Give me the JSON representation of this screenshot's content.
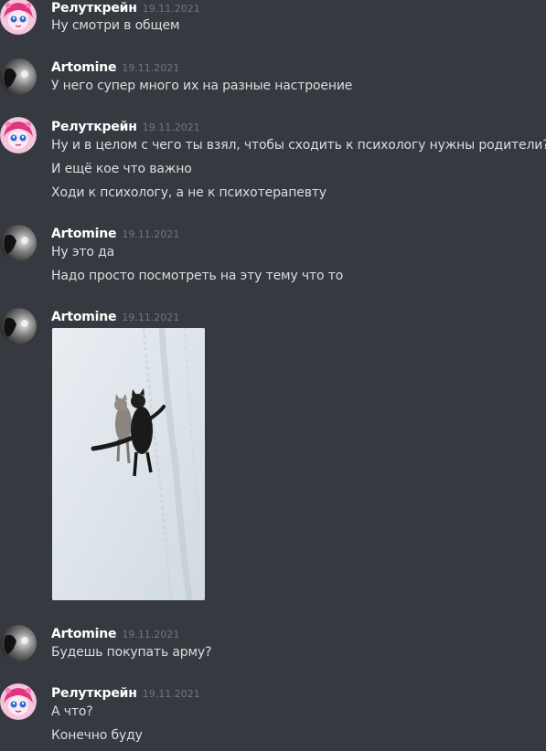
{
  "messages": [
    {
      "author": "Релуткрейн",
      "timestamp": "19.11.2021",
      "lines": [
        "Ну смотри в общем"
      ]
    },
    {
      "author": "Artomine",
      "timestamp": "19.11.2021",
      "lines": [
        "У него супер много их на разные настроение"
      ]
    },
    {
      "author": "Релуткрейн",
      "timestamp": "19.11.2021",
      "lines": [
        "Ну и в целом с чего ты взял, чтобы сходить к психологу нужны родители?",
        "И ещё кое что важно",
        "Ходи к психологу, а не к психотерапевту"
      ]
    },
    {
      "author": "Artomine",
      "timestamp": "19.11.2021",
      "lines": [
        "Ну это да",
        "Надо просто посмотреть на эту тему что то"
      ]
    },
    {
      "author": "Artomine",
      "timestamp": "19.11.2021",
      "lines": [],
      "attachment": "image: two cats walking on snow"
    },
    {
      "author": "Artomine",
      "timestamp": "19.11.2021",
      "lines": [
        "Будешь покупать арму?"
      ]
    },
    {
      "author": "Релуткрейн",
      "timestamp": "19.11.2021",
      "lines": [
        "А что?",
        "Конечно буду"
      ]
    }
  ],
  "colors": {
    "background": "#36393f",
    "username": "#ffffff",
    "text": "#dcddde",
    "timestamp": "#72767d"
  },
  "icons": {
    "relutkrein_avatar": "pink-anime-avatar-icon",
    "artomine_avatar": "dark-cat-avatar-icon"
  }
}
